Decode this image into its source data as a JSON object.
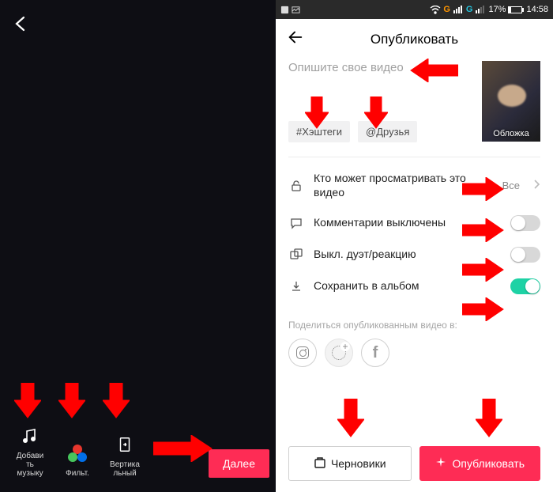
{
  "left": {
    "tools": {
      "music": "Добави\nть\nмузыку",
      "filter": "Фильт.",
      "vertical": "Вертика\nльный"
    },
    "next_label": "Далее"
  },
  "right": {
    "status": {
      "battery_percent": "17%",
      "time": "14:58"
    },
    "title": "Опубликовать",
    "description_placeholder": "Опишите свое видео",
    "tag_buttons": {
      "hashtags": "#Хэштеги",
      "friends": "@Друзья"
    },
    "cover_label": "Обложка",
    "settings": {
      "privacy": {
        "label": "Кто может просматривать это видео",
        "value": "Все"
      },
      "comments": {
        "label": "Комментарии выключены"
      },
      "duet": {
        "label": "Выкл. дуэт/реакцию"
      },
      "save": {
        "label": "Сохранить в альбом"
      }
    },
    "share_label": "Поделиться опубликованным видео в:",
    "actions": {
      "drafts": "Черновики",
      "publish": "Опубликовать"
    }
  }
}
